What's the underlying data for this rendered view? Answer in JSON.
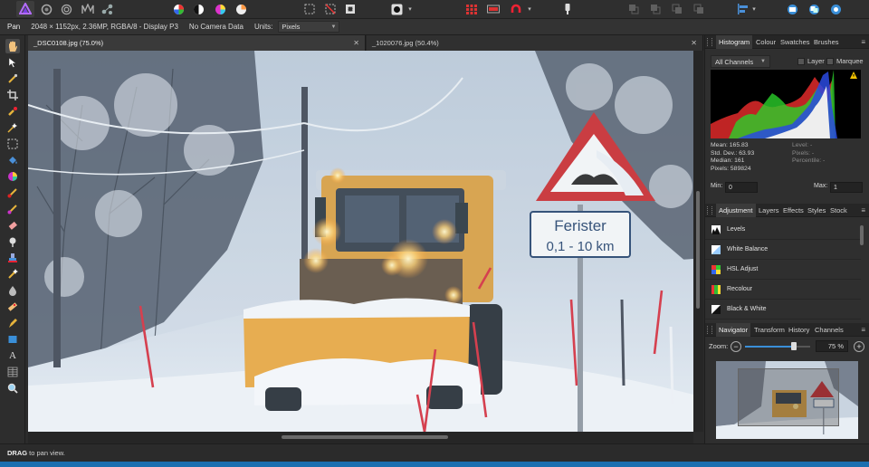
{
  "context_toolbar": {
    "tool_name": "Pan",
    "doc_info": "2048 × 1152px, 2.36MP, RGBA/8 - Display P3",
    "camera": "No Camera Data",
    "units_label": "Units:",
    "units_value": "Pixels"
  },
  "document_tabs": [
    {
      "label": "_DSC0108.jpg (75.0%)",
      "active": true
    },
    {
      "label": "_1020076.jpg (50.4%)",
      "active": false
    }
  ],
  "canvas": {
    "sign_line1": "Ferister",
    "sign_line2": "0,1 - 10 km"
  },
  "status_bar": {
    "key": "DRAG",
    "text": " to pan view."
  },
  "panel_histogram": {
    "tabs": [
      "Histogram",
      "Colour",
      "Swatches",
      "Brushes"
    ],
    "channel_select": "All Channels",
    "layer_label": "Layer",
    "marquee_label": "Marquee",
    "stats_left": {
      "mean": "Mean: 165.83",
      "std_dev": "Std. Dev.: 63.93",
      "median": "Median: 161",
      "pixels": "Pixels: 589824"
    },
    "stats_right": {
      "level": "Level: -",
      "pixels": "Pixels: -",
      "percentile": "Percentile: -"
    },
    "min_label": "Min:",
    "min_value": "0",
    "max_label": "Max:",
    "max_value": "1"
  },
  "panel_adjustment": {
    "tabs": [
      "Adjustment",
      "Layers",
      "Effects",
      "Styles",
      "Stock"
    ],
    "items": [
      "Levels",
      "White Balance",
      "HSL Adjust",
      "Recolour",
      "Black & White"
    ]
  },
  "panel_navigator": {
    "tabs": [
      "Navigator",
      "Transform",
      "History",
      "Channels"
    ],
    "zoom_label": "Zoom:",
    "zoom_value": "75 %",
    "zoom_level": 0.75
  },
  "colors": {
    "accent_blue": "#1b6fb0",
    "affinity_purple": "#7a3fe0",
    "sign_red": "#c8262b",
    "plow_orange": "#e9a53c"
  },
  "icons": {
    "toolbar": [
      "affinity-photo-persona-icon",
      "liquify-persona-icon",
      "develop-persona-icon",
      "tone-mapping-persona-icon",
      "export-persona-icon",
      "auto-levels-icon",
      "auto-contrast-icon",
      "auto-colours-icon",
      "auto-white-balance-icon",
      "marquee-icon",
      "deselect-icon",
      "invert-selection-icon",
      "quick-mask-icon",
      "assistant-icon",
      "snapping-icon",
      "red-eye-icon",
      "order-icons",
      "align-icon",
      "arrange-icons"
    ]
  }
}
